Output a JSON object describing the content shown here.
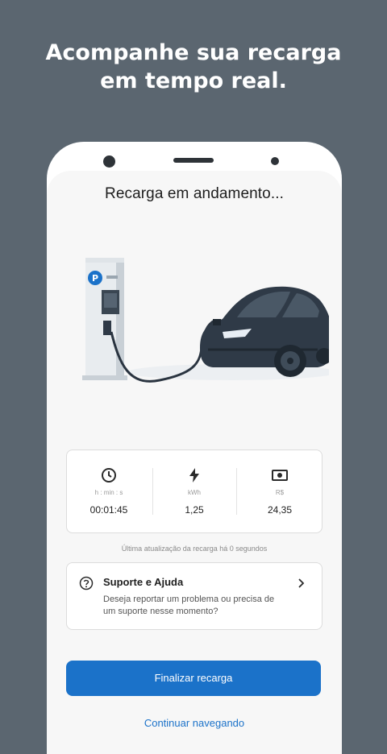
{
  "headline": {
    "line1": "Acompanhe sua recarga",
    "line2": "em tempo real."
  },
  "screen": {
    "title": "Recarga em andamento..."
  },
  "stats": [
    {
      "icon": "clock-icon",
      "unit": "h : min : s",
      "value": "00:01:45"
    },
    {
      "icon": "lightning-icon",
      "unit": "kWh",
      "value": "1,25"
    },
    {
      "icon": "money-icon",
      "unit": "R$",
      "value": "24,35"
    }
  ],
  "update_text": "Última atualização da recarga há 0 segundos",
  "support": {
    "title": "Suporte e Ajuda",
    "description": "Deseja reportar um problema ou precisa de um suporte nesse momento?"
  },
  "buttons": {
    "finish": "Finalizar recarga",
    "continue": "Continuar navegando"
  },
  "colors": {
    "primary": "#1b72c9",
    "background": "#5b6670",
    "car": "#2f3a47"
  }
}
